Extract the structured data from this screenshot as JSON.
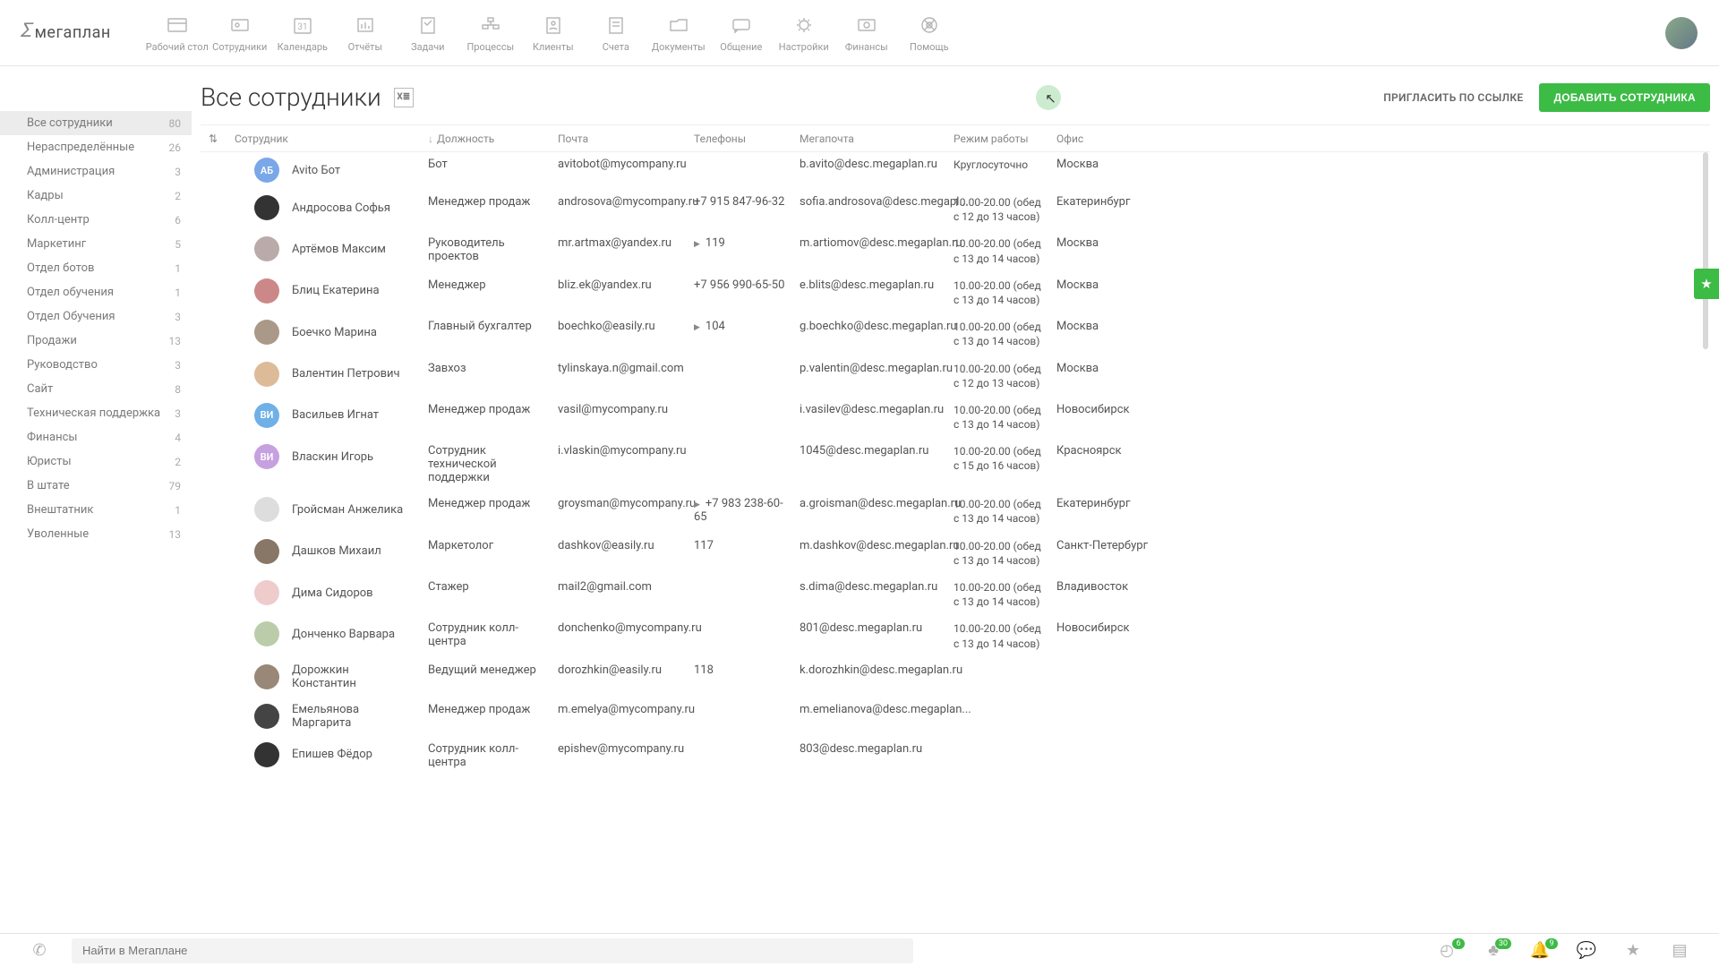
{
  "logo": "мегаплан",
  "topnav": [
    {
      "label": "Рабочий стол"
    },
    {
      "label": "Сотрудники"
    },
    {
      "label": "Календарь"
    },
    {
      "label": "Отчёты"
    },
    {
      "label": "Задачи"
    },
    {
      "label": "Процессы"
    },
    {
      "label": "Клиенты"
    },
    {
      "label": "Счета"
    },
    {
      "label": "Документы"
    },
    {
      "label": "Общение"
    },
    {
      "label": "Настройки"
    },
    {
      "label": "Финансы"
    },
    {
      "label": "Помощь"
    }
  ],
  "sidebar": [
    {
      "name": "Все сотрудники",
      "count": "80",
      "active": true
    },
    {
      "name": "Нераспределённые",
      "count": "26"
    },
    {
      "name": "Администрация",
      "count": "3"
    },
    {
      "name": "Кадры",
      "count": "2"
    },
    {
      "name": "Колл-центр",
      "count": "6"
    },
    {
      "name": "Маркетинг",
      "count": "5"
    },
    {
      "name": "Отдел ботов",
      "count": "1"
    },
    {
      "name": "Отдел обучения",
      "count": "1"
    },
    {
      "name": "Отдел Обучения",
      "count": "3"
    },
    {
      "name": "Продажи",
      "count": "13"
    },
    {
      "name": "Руководство",
      "count": "3"
    },
    {
      "name": "Сайт",
      "count": "8"
    },
    {
      "name": "Техническая поддержка",
      "count": "3"
    },
    {
      "name": "Финансы",
      "count": "4"
    },
    {
      "name": "Юристы",
      "count": "2"
    },
    {
      "name": "В штате",
      "count": "79"
    },
    {
      "name": "Внештатник",
      "count": "1"
    },
    {
      "name": "Уволенные",
      "count": "13"
    }
  ],
  "page_title": "Все сотрудники",
  "invite_label": "ПРИГЛАСИТЬ ПО ССЫЛКЕ",
  "add_label": "ДОБАВИТЬ СОТРУДНИКА",
  "columns": {
    "employee": "Сотрудник",
    "position": "Должность",
    "mail": "Почта",
    "phones": "Телефоны",
    "megamail": "Мегапочта",
    "schedule": "Режим работы",
    "office": "Офис"
  },
  "rows": [
    {
      "initials": "АБ",
      "color": "#7aa7e8",
      "name": "Avito Бот",
      "pos": "Бот",
      "mail": "avitobot@mycompany.ru",
      "phone": "",
      "mp": "b.avito@desc.megaplan.ru",
      "sched": "Круглосуточно",
      "office": "Москва"
    },
    {
      "img": true,
      "color": "#333",
      "name": "Андросова Софья",
      "pos": "Менеджер продаж",
      "mail": "androsova@mycompany.ru",
      "phone": "+7 915 847-96-32",
      "mp": "sofia.androsova@desc.megapl...",
      "sched": "10.00-20.00 (обед с 12 до 13 часов)",
      "office": "Екатеринбург"
    },
    {
      "img": true,
      "color": "#baa",
      "name": "Артёмов Максим",
      "pos": "Руководитель проектов",
      "mail": "mr.artmax@yandex.ru",
      "phone": "119",
      "caret": true,
      "mp": "m.artiomov@desc.megaplan.ru",
      "sched": "10.00-20.00 (обед с 13 до 14 часов)",
      "office": "Москва"
    },
    {
      "img": true,
      "color": "#c88",
      "name": "Блиц Екатерина",
      "pos": "Менеджер",
      "mail": "bliz.ek@yandex.ru",
      "phone": "+7 956 990-65-50",
      "mp": "e.blits@desc.megaplan.ru",
      "sched": "10.00-20.00 (обед с 13 до 14 часов)",
      "office": "Москва"
    },
    {
      "img": true,
      "color": "#a98",
      "name": "Боечко Марина",
      "pos": "Главный бухгалтер",
      "mail": "boechko@easily.ru",
      "phone": "104",
      "caret": true,
      "mp": "g.boechko@desc.megaplan.ru",
      "sched": "10.00-20.00 (обед с 13 до 14 часов)",
      "office": "Москва"
    },
    {
      "img": true,
      "color": "#db9",
      "name": "Валентин Петрович",
      "pos": "Завхоз",
      "mail": "tylinskaya.n@gmail.com",
      "phone": "",
      "mp": "p.valentin@desc.megaplan.ru",
      "sched": "10.00-20.00 (обед с 12 до 13 часов)",
      "office": "Москва"
    },
    {
      "initials": "ВИ",
      "color": "#6fb1e6",
      "name": "Васильев Игнат",
      "pos": "Менеджер продаж",
      "mail": "vasil@mycompany.ru",
      "phone": "",
      "mp": "i.vasilev@desc.megaplan.ru",
      "sched": "10.00-20.00 (обед с 13 до 14 часов)",
      "office": "Новосибирск"
    },
    {
      "initials": "ВИ",
      "color": "#c7a0e0",
      "name": "Власкин Игорь",
      "pos": "Сотрудник технической поддержки",
      "mail": "i.vlaskin@mycompany.ru",
      "phone": "",
      "mp": "1045@desc.megaplan.ru",
      "sched": "10.00-20.00 (обед с 15 до 16 часов)",
      "office": "Красноярск"
    },
    {
      "img": true,
      "color": "#ddd",
      "name": "Гройсман Анжелика",
      "pos": "Менеджер продаж",
      "mail": "groysman@mycompany.ru",
      "phone": "+7 983 238-60-65",
      "caret": true,
      "mp": "a.groisman@desc.megaplan.ru",
      "sched": "10.00-20.00 (обед с 13 до 14 часов)",
      "office": "Екатеринбург"
    },
    {
      "img": true,
      "color": "#876",
      "name": "Дашков Михаил",
      "pos": "Маркетолог",
      "mail": "dashkov@easily.ru",
      "phone": "117",
      "mp": "m.dashkov@desc.megaplan.ru",
      "sched": "10.00-20.00 (обед с 13 до 14 часов)",
      "office": "Санкт-Петербург"
    },
    {
      "img": true,
      "color": "#ecc",
      "name": "Дима Сидоров",
      "pos": "Стажер",
      "mail": "mail2@gmail.com",
      "phone": "",
      "mp": "s.dima@desc.megaplan.ru",
      "sched": "10.00-20.00 (обед с 13 до 14 часов)",
      "office": "Владивосток"
    },
    {
      "img": true,
      "color": "#bca",
      "name": "Донченко Варвара",
      "pos": "Сотрудник колл-центра",
      "mail": "donchenko@mycompany.ru",
      "phone": "",
      "mp": "801@desc.megaplan.ru",
      "sched": "10.00-20.00 (обед с 13 до 14 часов)",
      "office": "Новосибирск"
    },
    {
      "img": true,
      "color": "#987",
      "name": "Дорожкин Константин",
      "pos": "Ведущий менеджер",
      "mail": "dorozhkin@easily.ru",
      "phone": "118",
      "mp": "k.dorozhkin@desc.megaplan.ru",
      "sched": "",
      "office": ""
    },
    {
      "img": true,
      "color": "#444",
      "name": "Емельянова Маргарита",
      "pos": "Менеджер продаж",
      "mail": "m.emelya@mycompany.ru",
      "phone": "",
      "mp": "m.emelianova@desc.megaplan...",
      "sched": "",
      "office": ""
    },
    {
      "img": true,
      "color": "#333",
      "name": "Епишев Фёдор",
      "pos": "Сотрудник колл-центра",
      "mail": "epishev@mycompany.ru",
      "phone": "",
      "mp": "803@desc.megaplan.ru",
      "sched": "",
      "office": ""
    }
  ],
  "search_placeholder": "Найти в Мегаплане",
  "badges": {
    "clock": "6",
    "fire": "30",
    "bell": "9"
  }
}
